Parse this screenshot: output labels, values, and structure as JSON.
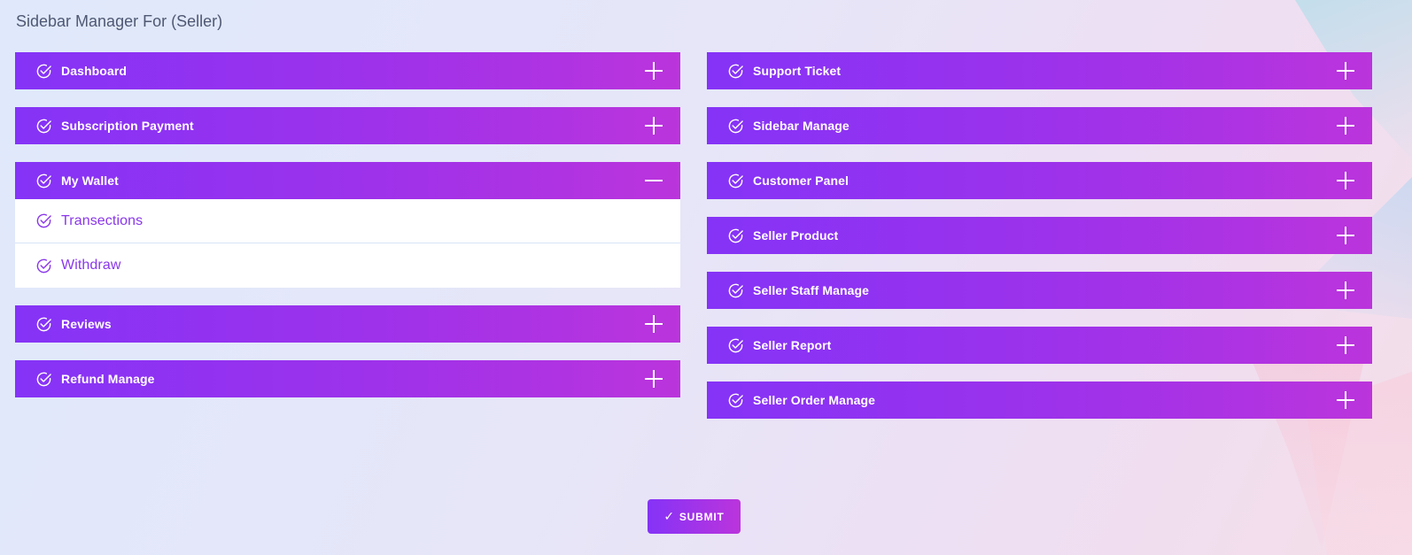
{
  "page_title": "Sidebar Manager For (Seller)",
  "colors": {
    "accent_start": "#8533f7",
    "accent_end": "#bb34dc",
    "sub_text": "#8a37ea"
  },
  "left_panels": [
    {
      "label": "Dashboard",
      "state": "collapsed",
      "icon": "check-circle-icon"
    },
    {
      "label": "Subscription Payment",
      "state": "collapsed",
      "icon": "check-circle-icon"
    },
    {
      "label": "My Wallet",
      "state": "expanded",
      "icon": "check-circle-icon",
      "children": [
        {
          "label": "Transections"
        },
        {
          "label": "Withdraw"
        }
      ]
    },
    {
      "label": "Reviews",
      "state": "collapsed",
      "icon": "check-circle-icon"
    },
    {
      "label": "Refund Manage",
      "state": "collapsed",
      "icon": "check-circle-icon"
    }
  ],
  "right_panels": [
    {
      "label": "Support Ticket",
      "state": "collapsed"
    },
    {
      "label": "Sidebar Manage",
      "state": "collapsed"
    },
    {
      "label": "Customer Panel",
      "state": "collapsed"
    },
    {
      "label": "Seller Product",
      "state": "collapsed"
    },
    {
      "label": "Seller Staff Manage",
      "state": "collapsed"
    },
    {
      "label": "Seller Report",
      "state": "collapsed"
    },
    {
      "label": "Seller Order Manage",
      "state": "collapsed"
    }
  ],
  "submit": {
    "label": "SUBMIT",
    "icon": "checkmark-icon"
  }
}
